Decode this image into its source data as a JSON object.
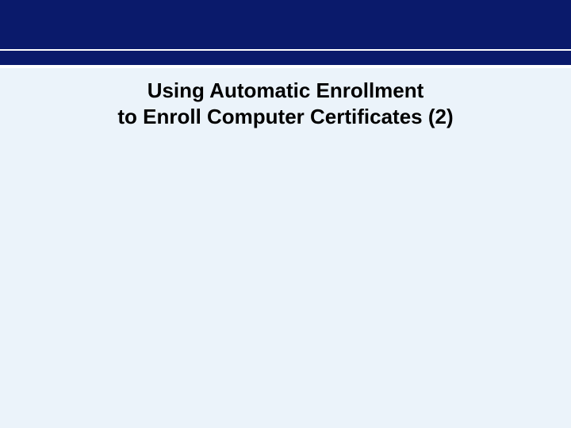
{
  "slide": {
    "title_line1": "Using Automatic Enrollment",
    "title_line2": "to Enroll Computer Certificates (2)"
  }
}
